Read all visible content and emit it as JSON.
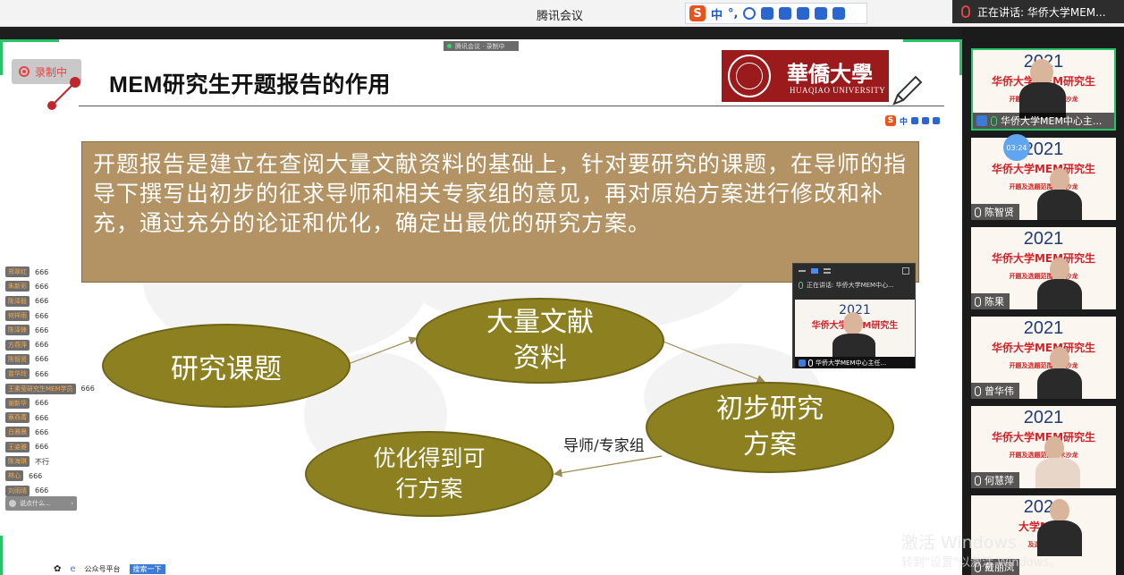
{
  "titlebar": {
    "app_title": "腾讯会议",
    "speaking": "正在讲话: 华侨大学MEM..."
  },
  "ime": {
    "label": "中",
    "mini_label": "中"
  },
  "slide": {
    "meeting_chip": "腾讯会议 · 录制中",
    "record_badge": "录制中",
    "title": "MEM研究生开题报告的作用",
    "logo_cn": "華僑大學",
    "logo_en": "HUAQIAO UNIVERSITY",
    "definition": "开题报告是建立在查阅大量文献资料的基础上，针对要研究的课题，在导师的指导下撰写出初步的征求导师和相关专家组的意见，再对原始方案进行修改和补充，通过充分的论证和优化，确定出最优的研究方案。",
    "diagram": {
      "n1": "研究课题",
      "n2_line1": "大量文献",
      "n2_line2": "资料",
      "n3_line1": "初步研究",
      "n3_line2": "方案",
      "n4_line1": "优化得到可",
      "n4_line2": "行方案",
      "arrow_label": "导师/专家组"
    }
  },
  "chat": {
    "messages": [
      {
        "name": "郑翠红",
        "msg": "666"
      },
      {
        "name": "朱新彩",
        "msg": "666"
      },
      {
        "name": "陈泽毅",
        "msg": "666"
      },
      {
        "name": "何祥雨",
        "msg": "666"
      },
      {
        "name": "陈泽锋",
        "msg": "666"
      },
      {
        "name": "方燕萍",
        "msg": "666"
      },
      {
        "name": "陈智贤",
        "msg": "666"
      },
      {
        "name": "曾华玲",
        "msg": "666"
      },
      {
        "name": "王素莹研究生MEM学员",
        "msg": "666"
      },
      {
        "name": "谢新华",
        "msg": "666"
      },
      {
        "name": "蔡燕菁",
        "msg": "666"
      },
      {
        "name": "白雅晨",
        "msg": "666"
      },
      {
        "name": "王姿雅",
        "msg": "666"
      },
      {
        "name": "陈海琪",
        "msg": "不行"
      },
      {
        "name": "林心",
        "msg": "666"
      },
      {
        "name": "刘雨晴",
        "msg": "666"
      }
    ],
    "input_placeholder": "说点什么..."
  },
  "pip": {
    "speaking": "正在讲话: 华侨大学MEM中心...",
    "name": "华侨大学MEM中心主任..."
  },
  "bottom": {
    "app": "公众号平台",
    "search": "搜索一下"
  },
  "panel": {
    "timer": "03:24",
    "tiles": [
      {
        "year": "2021",
        "title": "华侨大学MEM研究生",
        "sub": "开题及选题范围学术沙龙",
        "name": "华侨大学MEM中心主..."
      },
      {
        "year": "2021",
        "title": "华侨大学MEM研究生",
        "sub": "开题及选题范围学术沙龙",
        "name": "陈智贤"
      },
      {
        "year": "2021",
        "title": "华侨大学MEM研究生",
        "sub": "开题及选题范围学术沙龙",
        "name": "陈果"
      },
      {
        "year": "2021",
        "title": "华侨大学MEM研究生",
        "sub": "开题及选题范围学术沙龙",
        "name": "曾华伟"
      },
      {
        "year": "2021",
        "title": "华侨大学MEM研究生",
        "sub": "开题及选题范围学术沙龙",
        "name": "何慧萍"
      },
      {
        "year": "2021",
        "title": "大学MEM",
        "sub": "及选题范围",
        "name": "戴丽凤"
      }
    ]
  },
  "watermark": {
    "line1": "激活 Windows",
    "line2": "转到\"设置\"以激活 Windows。"
  },
  "colors": {
    "accent_green": "#27c46b",
    "def_box": "#b39264",
    "ellipse": "#8d8020",
    "logo_red": "#9b1a1c"
  }
}
